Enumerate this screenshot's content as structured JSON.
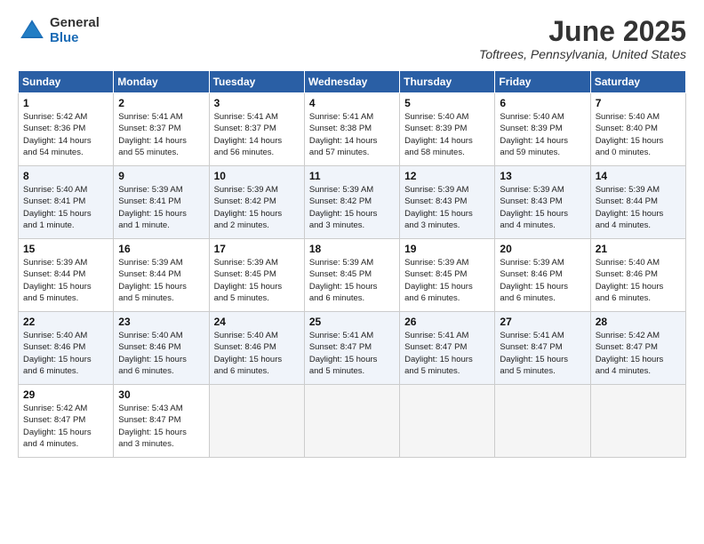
{
  "header": {
    "logo_general": "General",
    "logo_blue": "Blue",
    "month_title": "June 2025",
    "location": "Toftrees, Pennsylvania, United States"
  },
  "weekdays": [
    "Sunday",
    "Monday",
    "Tuesday",
    "Wednesday",
    "Thursday",
    "Friday",
    "Saturday"
  ],
  "weeks": [
    [
      {
        "day": "1",
        "info": "Sunrise: 5:42 AM\nSunset: 8:36 PM\nDaylight: 14 hours\nand 54 minutes."
      },
      {
        "day": "2",
        "info": "Sunrise: 5:41 AM\nSunset: 8:37 PM\nDaylight: 14 hours\nand 55 minutes."
      },
      {
        "day": "3",
        "info": "Sunrise: 5:41 AM\nSunset: 8:37 PM\nDaylight: 14 hours\nand 56 minutes."
      },
      {
        "day": "4",
        "info": "Sunrise: 5:41 AM\nSunset: 8:38 PM\nDaylight: 14 hours\nand 57 minutes."
      },
      {
        "day": "5",
        "info": "Sunrise: 5:40 AM\nSunset: 8:39 PM\nDaylight: 14 hours\nand 58 minutes."
      },
      {
        "day": "6",
        "info": "Sunrise: 5:40 AM\nSunset: 8:39 PM\nDaylight: 14 hours\nand 59 minutes."
      },
      {
        "day": "7",
        "info": "Sunrise: 5:40 AM\nSunset: 8:40 PM\nDaylight: 15 hours\nand 0 minutes."
      }
    ],
    [
      {
        "day": "8",
        "info": "Sunrise: 5:40 AM\nSunset: 8:41 PM\nDaylight: 15 hours\nand 1 minute."
      },
      {
        "day": "9",
        "info": "Sunrise: 5:39 AM\nSunset: 8:41 PM\nDaylight: 15 hours\nand 1 minute."
      },
      {
        "day": "10",
        "info": "Sunrise: 5:39 AM\nSunset: 8:42 PM\nDaylight: 15 hours\nand 2 minutes."
      },
      {
        "day": "11",
        "info": "Sunrise: 5:39 AM\nSunset: 8:42 PM\nDaylight: 15 hours\nand 3 minutes."
      },
      {
        "day": "12",
        "info": "Sunrise: 5:39 AM\nSunset: 8:43 PM\nDaylight: 15 hours\nand 3 minutes."
      },
      {
        "day": "13",
        "info": "Sunrise: 5:39 AM\nSunset: 8:43 PM\nDaylight: 15 hours\nand 4 minutes."
      },
      {
        "day": "14",
        "info": "Sunrise: 5:39 AM\nSunset: 8:44 PM\nDaylight: 15 hours\nand 4 minutes."
      }
    ],
    [
      {
        "day": "15",
        "info": "Sunrise: 5:39 AM\nSunset: 8:44 PM\nDaylight: 15 hours\nand 5 minutes."
      },
      {
        "day": "16",
        "info": "Sunrise: 5:39 AM\nSunset: 8:44 PM\nDaylight: 15 hours\nand 5 minutes."
      },
      {
        "day": "17",
        "info": "Sunrise: 5:39 AM\nSunset: 8:45 PM\nDaylight: 15 hours\nand 5 minutes."
      },
      {
        "day": "18",
        "info": "Sunrise: 5:39 AM\nSunset: 8:45 PM\nDaylight: 15 hours\nand 6 minutes."
      },
      {
        "day": "19",
        "info": "Sunrise: 5:39 AM\nSunset: 8:45 PM\nDaylight: 15 hours\nand 6 minutes."
      },
      {
        "day": "20",
        "info": "Sunrise: 5:39 AM\nSunset: 8:46 PM\nDaylight: 15 hours\nand 6 minutes."
      },
      {
        "day": "21",
        "info": "Sunrise: 5:40 AM\nSunset: 8:46 PM\nDaylight: 15 hours\nand 6 minutes."
      }
    ],
    [
      {
        "day": "22",
        "info": "Sunrise: 5:40 AM\nSunset: 8:46 PM\nDaylight: 15 hours\nand 6 minutes."
      },
      {
        "day": "23",
        "info": "Sunrise: 5:40 AM\nSunset: 8:46 PM\nDaylight: 15 hours\nand 6 minutes."
      },
      {
        "day": "24",
        "info": "Sunrise: 5:40 AM\nSunset: 8:46 PM\nDaylight: 15 hours\nand 6 minutes."
      },
      {
        "day": "25",
        "info": "Sunrise: 5:41 AM\nSunset: 8:47 PM\nDaylight: 15 hours\nand 5 minutes."
      },
      {
        "day": "26",
        "info": "Sunrise: 5:41 AM\nSunset: 8:47 PM\nDaylight: 15 hours\nand 5 minutes."
      },
      {
        "day": "27",
        "info": "Sunrise: 5:41 AM\nSunset: 8:47 PM\nDaylight: 15 hours\nand 5 minutes."
      },
      {
        "day": "28",
        "info": "Sunrise: 5:42 AM\nSunset: 8:47 PM\nDaylight: 15 hours\nand 4 minutes."
      }
    ],
    [
      {
        "day": "29",
        "info": "Sunrise: 5:42 AM\nSunset: 8:47 PM\nDaylight: 15 hours\nand 4 minutes."
      },
      {
        "day": "30",
        "info": "Sunrise: 5:43 AM\nSunset: 8:47 PM\nDaylight: 15 hours\nand 3 minutes."
      },
      {
        "day": "",
        "info": ""
      },
      {
        "day": "",
        "info": ""
      },
      {
        "day": "",
        "info": ""
      },
      {
        "day": "",
        "info": ""
      },
      {
        "day": "",
        "info": ""
      }
    ]
  ]
}
